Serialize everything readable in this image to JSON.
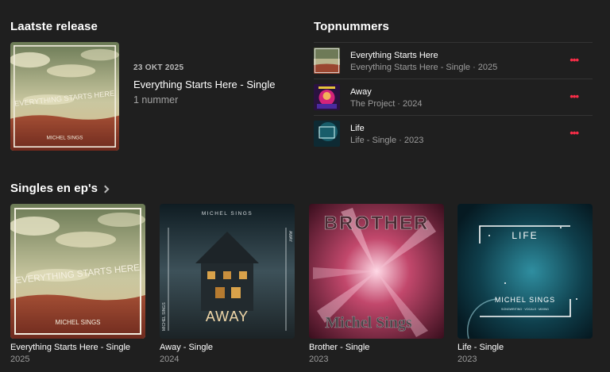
{
  "latest_release": {
    "heading": "Laatste release",
    "date": "23 OKT 2025",
    "title": "Everything Starts Here - Single",
    "count": "1 nummer",
    "cover_text": "EVERYTHING STARTS HERE",
    "cover_artist": "MICHEL SINGS"
  },
  "top_songs": {
    "heading": "Topnummers",
    "items": [
      {
        "title": "Everything Starts Here",
        "subtitle": "Everything Starts Here - Single · 2025",
        "art": "desert"
      },
      {
        "title": "Away",
        "subtitle": "The Project · 2024",
        "art": "neon"
      },
      {
        "title": "Life",
        "subtitle": "Life - Single · 2023",
        "art": "teal"
      }
    ],
    "more_label": "•••"
  },
  "singles": {
    "heading": "Singles en ep's",
    "items": [
      {
        "name": "Everything Starts Here - Single",
        "year": "2025",
        "cover_text": "EVERYTHING STARTS HERE",
        "artist": "MICHEL SINGS"
      },
      {
        "name": "Away - Single",
        "year": "2024",
        "cover_text": "AWAY",
        "artist": "MICHEL SINGS",
        "spine_left": "MICHEL SINGS",
        "spine_right": "AWAY"
      },
      {
        "name": "Brother - Single",
        "year": "2023",
        "cover_text": "BROTHER",
        "artist": "Michel Sings"
      },
      {
        "name": "Life - Single",
        "year": "2023",
        "cover_text": "LIFE",
        "artist": "MICHEL SINGS",
        "small_print": "SONGWRITING · VOCALS · MIXING"
      }
    ]
  },
  "colors": {
    "accent": "#fa2d48",
    "background": "#1f1f1f"
  }
}
